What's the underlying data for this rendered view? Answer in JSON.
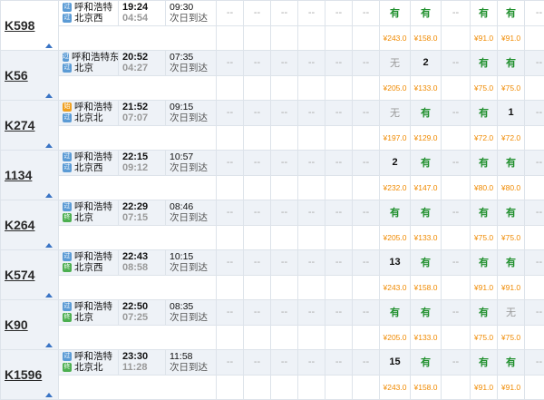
{
  "trains": [
    {
      "code": "K598",
      "from": "呼和浩特",
      "to": "北京西",
      "from_badge": "过",
      "to_badge": "过",
      "dep": "19:24",
      "dur": "04:54",
      "arr": "09:30",
      "arr_note": "次日到达",
      "seats": [
        "--",
        "--",
        "--",
        "--",
        "--",
        "--",
        "有",
        "有",
        "--",
        "有",
        "有",
        "--"
      ],
      "prices": [
        "",
        "",
        "",
        "",
        "",
        "",
        "¥243.0",
        "¥158.0",
        "",
        "¥91.0",
        "¥91.0",
        ""
      ]
    },
    {
      "code": "K56",
      "from": "呼和浩特东",
      "to": "北京",
      "from_badge": "过",
      "to_badge": "过",
      "dep": "20:52",
      "dur": "04:27",
      "arr": "07:35",
      "arr_note": "次日到达",
      "seats": [
        "--",
        "--",
        "--",
        "--",
        "--",
        "--",
        "无",
        "2",
        "--",
        "有",
        "有",
        "--"
      ],
      "prices": [
        "",
        "",
        "",
        "",
        "",
        "",
        "¥205.0",
        "¥133.0",
        "",
        "¥75.0",
        "¥75.0",
        ""
      ]
    },
    {
      "code": "K274",
      "from": "呼和浩特",
      "to": "北京北",
      "from_badge": "始",
      "to_badge": "过",
      "dep": "21:52",
      "dur": "07:07",
      "arr": "09:15",
      "arr_note": "次日到达",
      "seats": [
        "--",
        "--",
        "--",
        "--",
        "--",
        "--",
        "无",
        "有",
        "--",
        "有",
        "1",
        "--"
      ],
      "prices": [
        "",
        "",
        "",
        "",
        "",
        "",
        "¥197.0",
        "¥129.0",
        "",
        "¥72.0",
        "¥72.0",
        ""
      ]
    },
    {
      "code": "1134",
      "from": "呼和浩特",
      "to": "北京西",
      "from_badge": "过",
      "to_badge": "过",
      "dep": "22:15",
      "dur": "09:12",
      "arr": "10:57",
      "arr_note": "次日到达",
      "seats": [
        "--",
        "--",
        "--",
        "--",
        "--",
        "--",
        "2",
        "有",
        "--",
        "有",
        "有",
        "--"
      ],
      "prices": [
        "",
        "",
        "",
        "",
        "",
        "",
        "¥232.0",
        "¥147.0",
        "",
        "¥80.0",
        "¥80.0",
        ""
      ]
    },
    {
      "code": "K264",
      "from": "呼和浩特",
      "to": "北京",
      "from_badge": "过",
      "to_badge": "终",
      "dep": "22:29",
      "dur": "07:15",
      "arr": "08:46",
      "arr_note": "次日到达",
      "seats": [
        "--",
        "--",
        "--",
        "--",
        "--",
        "--",
        "有",
        "有",
        "--",
        "有",
        "有",
        "--"
      ],
      "prices": [
        "",
        "",
        "",
        "",
        "",
        "",
        "¥205.0",
        "¥133.0",
        "",
        "¥75.0",
        "¥75.0",
        ""
      ]
    },
    {
      "code": "K574",
      "from": "呼和浩特",
      "to": "北京西",
      "from_badge": "过",
      "to_badge": "终",
      "dep": "22:43",
      "dur": "08:58",
      "arr": "10:15",
      "arr_note": "次日到达",
      "seats": [
        "--",
        "--",
        "--",
        "--",
        "--",
        "--",
        "13",
        "有",
        "--",
        "有",
        "有",
        "--"
      ],
      "prices": [
        "",
        "",
        "",
        "",
        "",
        "",
        "¥243.0",
        "¥158.0",
        "",
        "¥91.0",
        "¥91.0",
        ""
      ]
    },
    {
      "code": "K90",
      "from": "呼和浩特",
      "to": "北京",
      "from_badge": "过",
      "to_badge": "终",
      "dep": "22:50",
      "dur": "07:25",
      "arr": "08:35",
      "arr_note": "次日到达",
      "seats": [
        "--",
        "--",
        "--",
        "--",
        "--",
        "--",
        "有",
        "有",
        "--",
        "有",
        "无",
        "--"
      ],
      "prices": [
        "",
        "",
        "",
        "",
        "",
        "",
        "¥205.0",
        "¥133.0",
        "",
        "¥75.0",
        "¥75.0",
        ""
      ]
    },
    {
      "code": "K1596",
      "from": "呼和浩特",
      "to": "北京北",
      "from_badge": "过",
      "to_badge": "终",
      "dep": "23:30",
      "dur": "11:28",
      "arr": "11:58",
      "arr_note": "次日到达",
      "seats": [
        "--",
        "--",
        "--",
        "--",
        "--",
        "--",
        "15",
        "有",
        "--",
        "有",
        "有",
        "--"
      ],
      "prices": [
        "",
        "",
        "",
        "",
        "",
        "",
        "¥243.0",
        "¥158.0",
        "",
        "¥91.0",
        "¥91.0",
        ""
      ]
    }
  ]
}
